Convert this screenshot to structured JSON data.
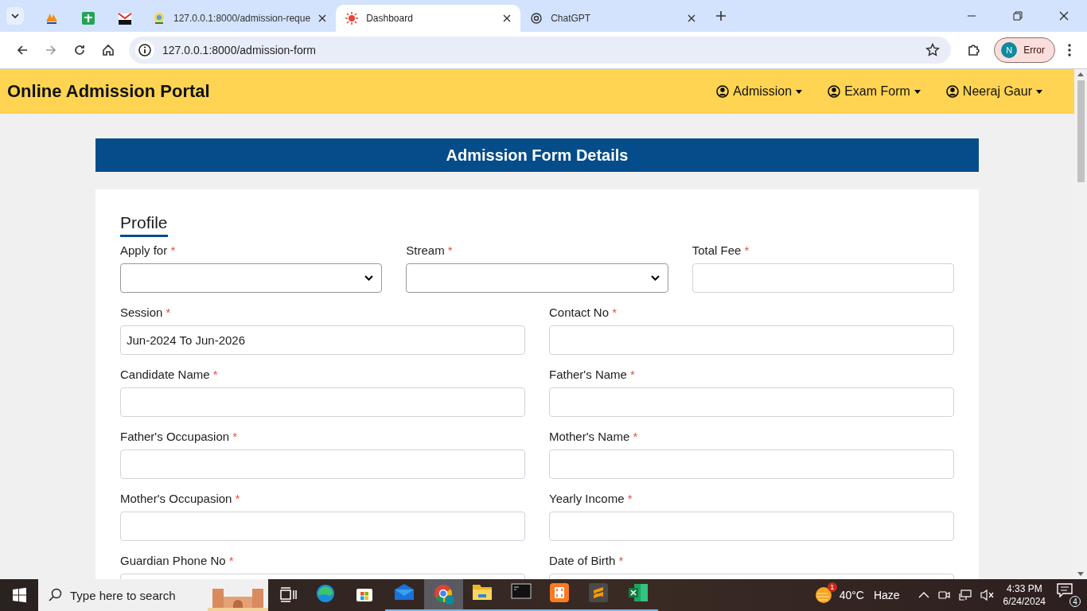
{
  "browser": {
    "tabs": [
      {
        "kind": "pinned",
        "selected": false
      },
      {
        "kind": "pinned",
        "selected": false
      },
      {
        "kind": "pinned",
        "selected": false
      },
      {
        "kind": "page",
        "title": "127.0.0.1:8000/admission-reque",
        "selected": false
      },
      {
        "kind": "page",
        "title": "Dashboard",
        "selected": true
      },
      {
        "kind": "page",
        "title": "ChatGPT",
        "selected": false
      }
    ],
    "address": "127.0.0.1:8000/admission-form",
    "profile": {
      "initial": "N",
      "label": "Error"
    }
  },
  "navbar": {
    "brand": "Online Admission Portal",
    "menus": [
      "Admission",
      "Exam Form",
      "Neeraj Gaur"
    ]
  },
  "form": {
    "header": "Admission Form Details",
    "section": "Profile",
    "rows": [
      [
        {
          "label": "Apply for",
          "mark": "*",
          "kind": "select"
        },
        {
          "label": "Stream",
          "mark": "*",
          "kind": "select"
        },
        {
          "label": "Total Fee",
          "mark": "*",
          "kind": "text"
        }
      ],
      [
        {
          "label": "Session",
          "mark": "*",
          "kind": "text",
          "value": "Jun-2024 To Jun-2026"
        },
        {
          "label": "Contact No",
          "mark": "*",
          "kind": "text"
        }
      ],
      [
        {
          "label": "Candidate Name",
          "mark": "*",
          "kind": "text"
        },
        {
          "label": "Father's Name",
          "mark": "*",
          "kind": "text"
        }
      ],
      [
        {
          "label": "Father's Occupasion",
          "mark": "*",
          "kind": "text"
        },
        {
          "label": "Mother's Name",
          "mark": "*",
          "kind": "text"
        }
      ],
      [
        {
          "label": "Mother's Occupasion",
          "mark": "*",
          "kind": "text"
        },
        {
          "label": "Yearly Income",
          "mark": "*",
          "kind": "text"
        }
      ],
      [
        {
          "label": "Guardian Phone No",
          "mark": "*",
          "kind": "text"
        },
        {
          "label": "Date of Birth",
          "mark": "*",
          "kind": "text"
        }
      ]
    ]
  },
  "taskbar": {
    "search_placeholder": "Type here to search",
    "apps": [
      {
        "kind": "taskview",
        "selected": false,
        "running": false
      },
      {
        "kind": "edge",
        "selected": false,
        "running": false
      },
      {
        "kind": "store",
        "selected": false,
        "running": false
      },
      {
        "kind": "mail",
        "selected": false,
        "running": true
      },
      {
        "kind": "chrome",
        "selected": true,
        "running": true
      },
      {
        "kind": "explorer",
        "selected": false,
        "running": true
      },
      {
        "kind": "terminal",
        "selected": false,
        "running": true
      },
      {
        "kind": "xampp",
        "selected": false,
        "running": true
      },
      {
        "kind": "sublime",
        "selected": false,
        "running": true
      },
      {
        "kind": "excel",
        "selected": false,
        "running": true
      }
    ],
    "weather": {
      "badge": "1",
      "temperature": "40°C",
      "condition": "Haze"
    },
    "time": "4:33 PM",
    "date": "6/24/2024",
    "notifications": "4"
  }
}
